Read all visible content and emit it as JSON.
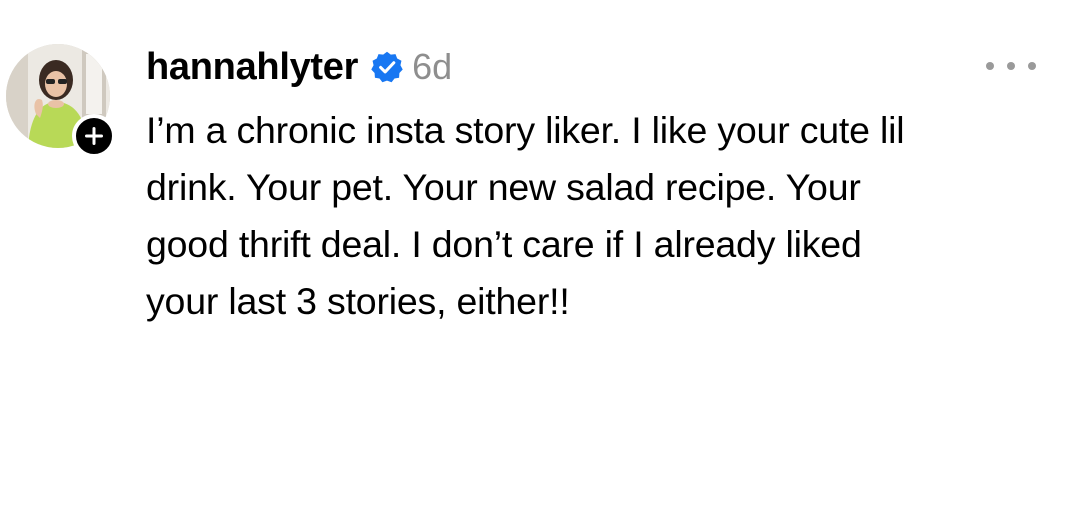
{
  "post": {
    "username": "hannahlyter",
    "verified_icon": "verified-badge-icon",
    "verified_color": "#1877f2",
    "time_ago": "6d",
    "more_icon": "more-options-icon",
    "add_icon": "plus-icon",
    "text_lines": [
      "I’m a chronic insta story liker. I like your cute lil",
      "drink. Your pet. Your new salad recipe. Your",
      "good thrift deal. I don’t care if I already liked",
      "your last 3 stories, either!!"
    ]
  }
}
